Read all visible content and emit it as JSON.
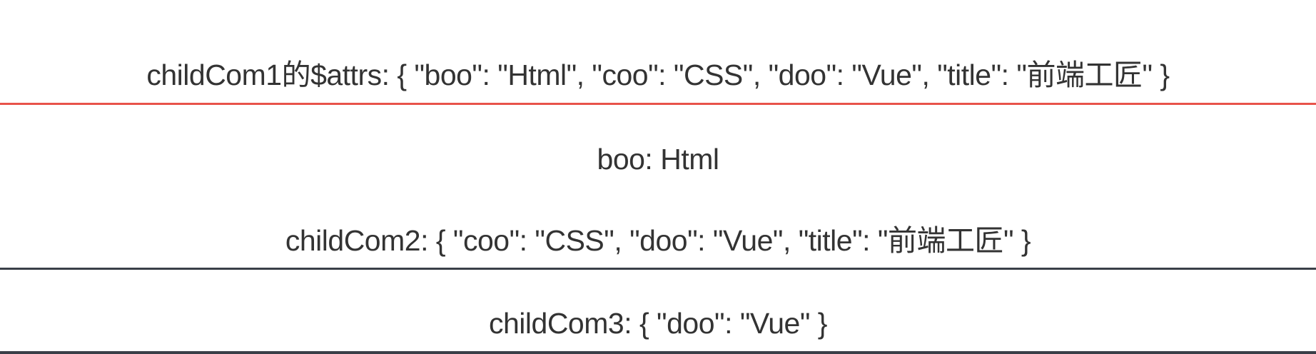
{
  "parent_block": {
    "attrs_line": "childCom1的$attrs: { \"boo\": \"Html\", \"coo\": \"CSS\", \"doo\": \"Vue\", \"title\": \"前端工匠\" }"
  },
  "child_com1": {
    "boo_line": "boo: Html",
    "child_com2_line": "childCom2: { \"coo\": \"CSS\", \"doo\": \"Vue\", \"title\": \"前端工匠\" }"
  },
  "child_com2": {
    "child_com3_line": "childCom3: { \"doo\": \"Vue\" }"
  },
  "colors": {
    "red_divider": "#e8534a",
    "dark_divider": "#3a3f48",
    "text": "#333333",
    "background": "#ffffff"
  }
}
